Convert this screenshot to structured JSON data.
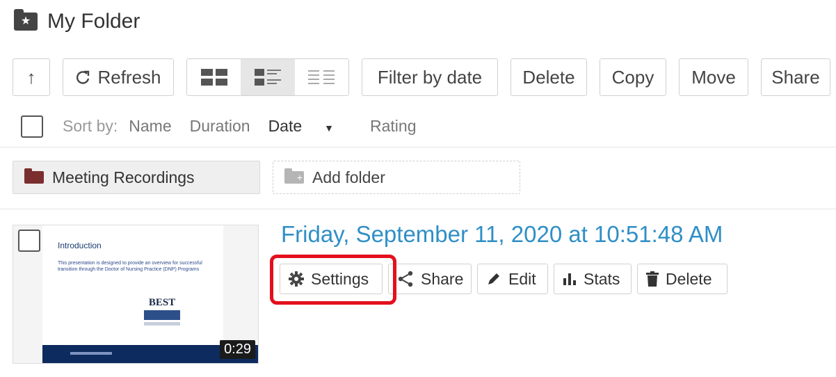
{
  "header": {
    "title": "My Folder",
    "icon": "folder-star-icon"
  },
  "toolbar": {
    "up_label": "↑",
    "refresh_label": "Refresh",
    "filter_label": "Filter by date",
    "delete_label": "Delete",
    "copy_label": "Copy",
    "move_label": "Move",
    "share_label": "Share",
    "active_view": "list"
  },
  "sort": {
    "label": "Sort by:",
    "options": [
      "Name",
      "Duration",
      "Date",
      "Rating"
    ],
    "active": "Date"
  },
  "folders": {
    "meeting": "Meeting Recordings",
    "add": "Add folder"
  },
  "recording": {
    "title": "Friday, September 11, 2020 at 10:51:48 AM",
    "duration": "0:29",
    "slide_title": "Introduction",
    "slide_body": "This presentation is designed to provide an overview for successful transition through the Doctor of Nursing Practice (DNP) Programs",
    "badge_text": "BEST",
    "actions": {
      "settings": "Settings",
      "share": "Share",
      "edit": "Edit",
      "stats": "Stats",
      "delete": "Delete"
    }
  },
  "colors": {
    "link": "#2f8fc6",
    "highlight": "#e3101c",
    "folder_dark": "#7a2e2e"
  }
}
